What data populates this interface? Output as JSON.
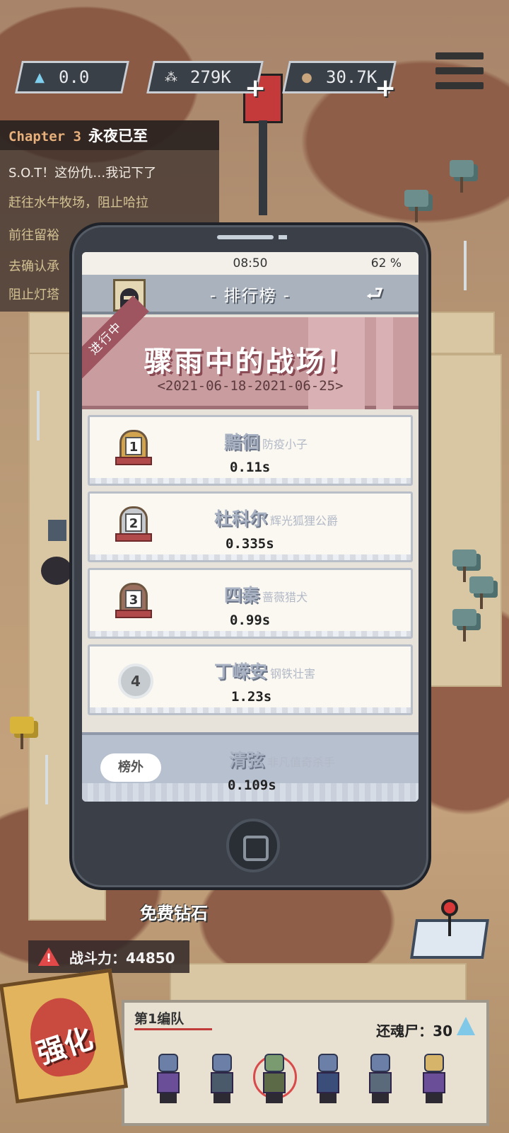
{
  "resources": [
    {
      "name": "diamond",
      "icon": "diamond-icon",
      "value": "0.0"
    },
    {
      "name": "gene",
      "icon": "gene-icon",
      "value": "279K"
    },
    {
      "name": "coin",
      "icon": "coin-icon",
      "value": "30.7K"
    }
  ],
  "quest": {
    "chapter_num": "Chapter 3",
    "chapter_title": "永夜已至",
    "lines": [
      "S.O.T！这份仇…我记下了",
      "赶往水牛牧场，阻止哈拉",
      "前往留裕",
      "去确认承",
      "阻止灯塔"
    ]
  },
  "phone": {
    "time": "08:50",
    "battery": "62 %",
    "title": "- 排行榜 -",
    "back_glyph": "⮐"
  },
  "event": {
    "ribbon": "进行中",
    "title": "骤雨中的战场！",
    "date": "<2021-06-18-2021-06-25>"
  },
  "leaderboard": [
    {
      "rank": "1",
      "name": "黯徊",
      "title": "防疫小子",
      "time": "0.11s"
    },
    {
      "rank": "2",
      "name": "杜科尔",
      "title": "辉光狐狸公爵",
      "time": "0.335s"
    },
    {
      "rank": "3",
      "name": "四秦",
      "title": "蔷薇猎犬",
      "time": "0.99s"
    },
    {
      "rank": "4",
      "name": "丁嵘安",
      "title": "钢铁壮害",
      "time": "1.23s"
    }
  ],
  "self": {
    "rank_label": "榜外",
    "name": "清弦",
    "title": "非凡值奇杀手",
    "time": "0.109s"
  },
  "hud": {
    "free_diamond": "免费钻石",
    "power": "战斗力：44850",
    "strengthen": "强化",
    "squad_name": "第1编队",
    "revive": "还魂尸：30"
  },
  "colors": {
    "banner": "#c99ca0",
    "appbar": "#aab2bd",
    "gold": "#d3a44f",
    "silver": "#c6cacf",
    "bronze": "#9b6f5e"
  }
}
